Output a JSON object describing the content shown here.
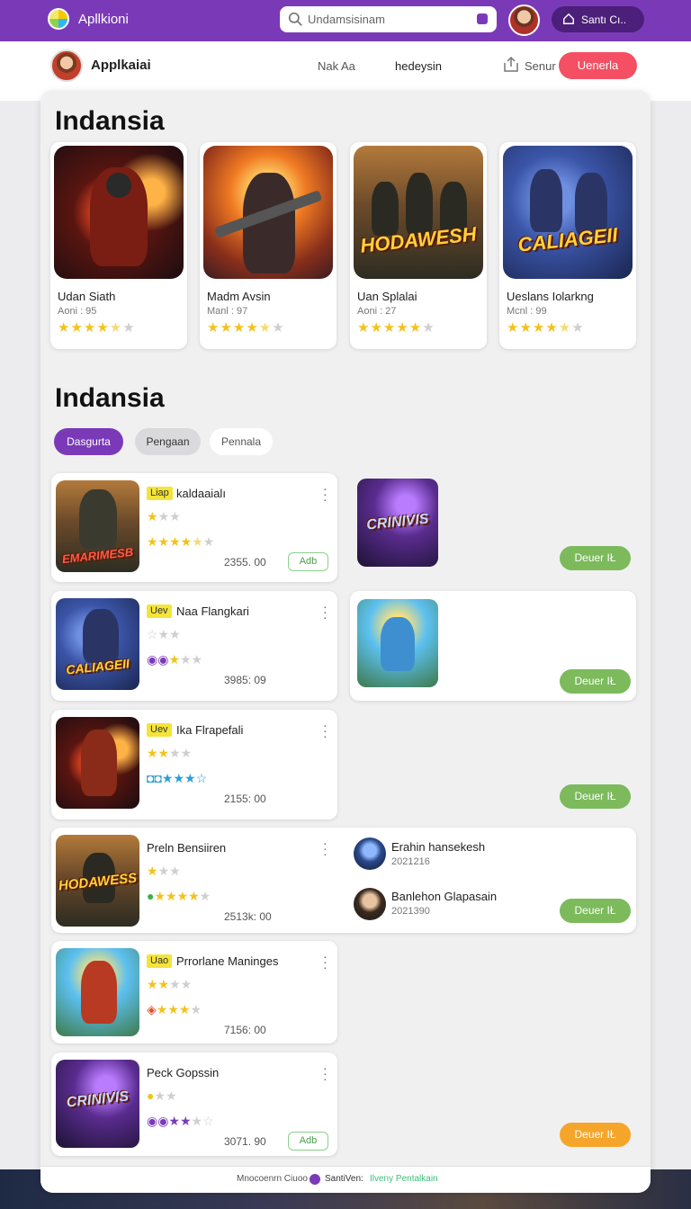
{
  "topbar": {
    "app_title": "Apllkioni",
    "search_placeholder": "Undamsisinam",
    "pill_label": "Santı Cı.."
  },
  "subbar": {
    "brand": "Applkaiai",
    "link1": "Nak Aa",
    "link2": "hedeysin",
    "share_label": "Senur",
    "cta_label": "Uenerla"
  },
  "featured": {
    "title": "Indansia",
    "items": [
      {
        "name": "Udan Siath",
        "meta": "Aoni : 95",
        "rating": 4.5
      },
      {
        "name": "Madm Avsin",
        "meta": "Manl : 97",
        "rating": 4.5
      },
      {
        "name": "Uan Splalai",
        "meta": "Aoni : 27",
        "rating": 5
      },
      {
        "name": "Ueslans Iolarkng",
        "meta": "Mcnl : 99",
        "rating": 4.5
      }
    ],
    "art_labels": [
      "HODAWESH",
      "CALIAGEII"
    ]
  },
  "list_section": {
    "title": "Indansia",
    "chips": [
      "Dasgurta",
      "Pengaan",
      "Pennala"
    ],
    "cards": [
      {
        "tag": "Liap",
        "title": "kaldaaialı",
        "number": "2355. 00",
        "add": "Adb",
        "art_label": "EMARIMESB"
      },
      {
        "tag": "Uev",
        "title": "Naa Flangkari",
        "number": "3985: 09",
        "art_label": "CALIAGEII"
      },
      {
        "tag": "Uev",
        "title": "Ika Flrapefali",
        "number": "2155: 00"
      },
      {
        "tag": "",
        "title": "Preln Bensiiren",
        "number": "2513k: 00",
        "art_label": "HODAWESS"
      },
      {
        "tag": "Uao",
        "title": "Prrorlane Maninges",
        "number": "7156: 00"
      },
      {
        "tag": "",
        "title": "Peck Gopssin",
        "number": "3071. 90",
        "add": "Adb",
        "art_label": "CRINIVIS"
      }
    ],
    "download_label": "Deuer IŁ",
    "right_art_label": "CRINIVIS",
    "people": [
      {
        "name": "Erahin hansekesh",
        "number": "2021216"
      },
      {
        "name": "Banlehon Glapasain",
        "number": "2021390"
      }
    ]
  },
  "footer": {
    "text": "Mnocoenrn Ciuoo",
    "select_label": "SantiVen:",
    "link": "Ilveny Pentalkain"
  },
  "colors": {
    "brand_purple": "#7a3ab8",
    "cta_red": "#f44f62",
    "download_green": "#7cba5c",
    "download_orange": "#f5a52a",
    "star_yellow": "#f3c21b"
  }
}
